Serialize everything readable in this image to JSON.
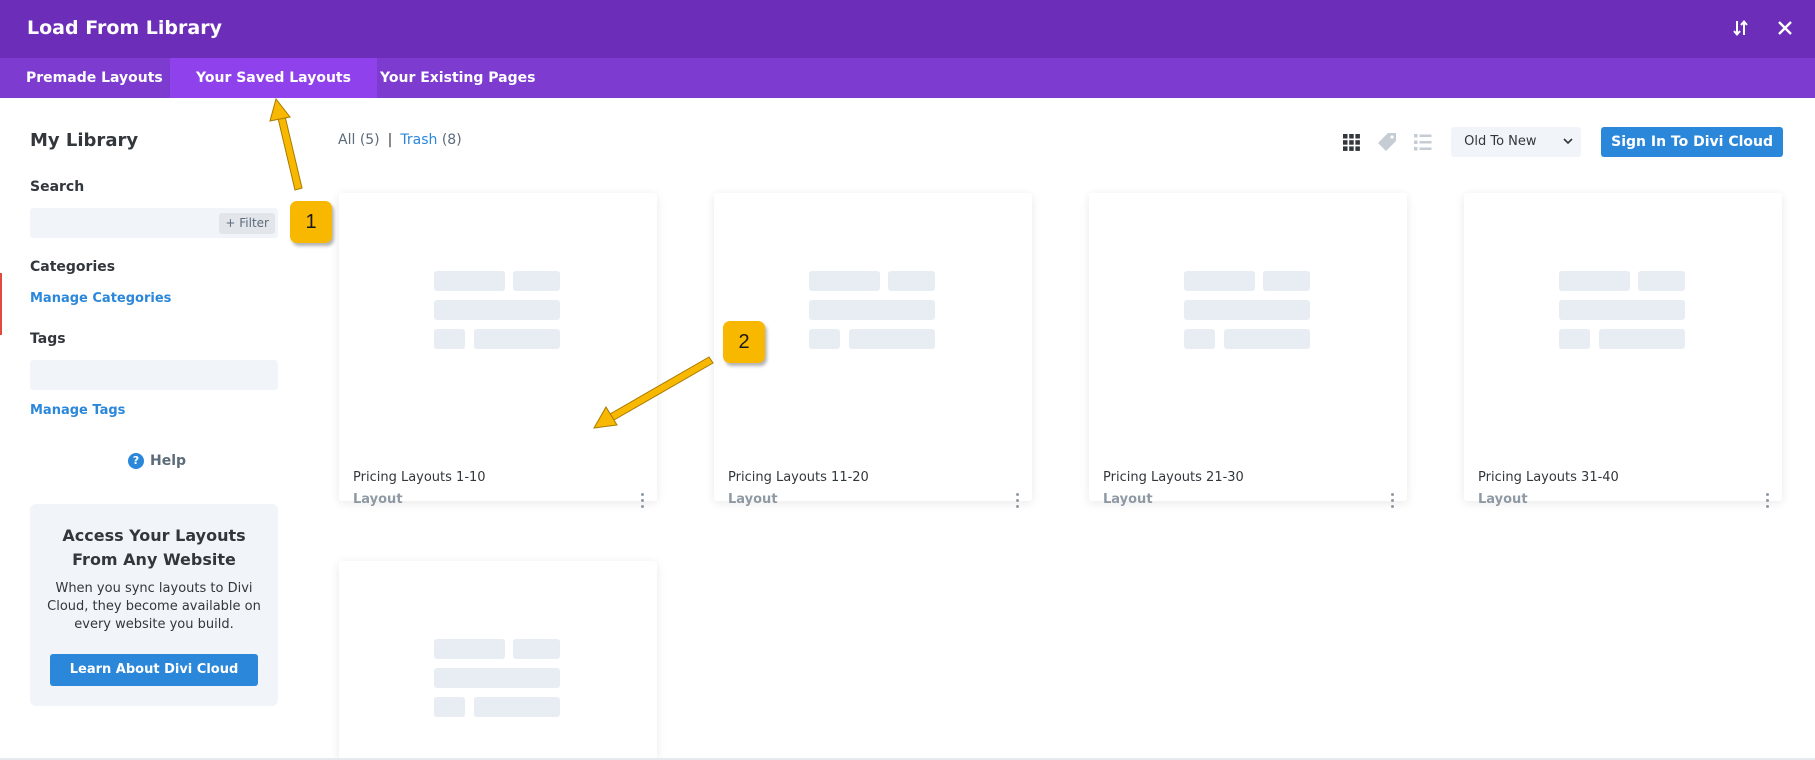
{
  "window": {
    "title": "Load From Library"
  },
  "title_icons": [
    {
      "name": "sort-arrows-icon"
    },
    {
      "name": "close-icon"
    }
  ],
  "tabs": [
    {
      "label": "Premade Layouts",
      "active": false
    },
    {
      "label": "Your Saved Layouts",
      "active": true
    },
    {
      "label": "Your Existing Pages",
      "active": false
    }
  ],
  "sidebar": {
    "heading": "My Library",
    "search_label": "Search",
    "search_placeholder": "",
    "filter_label": "+ Filter",
    "categories_label": "Categories",
    "manage_categories": "Manage Categories",
    "tags_label": "Tags",
    "manage_tags": "Manage Tags",
    "help_icon_glyph": "?",
    "help_label": "Help",
    "promo": {
      "title": "Access Your Layouts From Any Website",
      "text": "When you sync layouts to Divi Cloud, they become available on every website you build.",
      "button": "Learn About Divi Cloud"
    }
  },
  "filter": {
    "all_label": "All",
    "all_count": "(5)",
    "separator": "|",
    "trash_label": "Trash",
    "trash_count": "(8)"
  },
  "toolbar": {
    "view_icons": [
      "grid-view-icon",
      "tag-icon",
      "list-view-icon"
    ],
    "sort_value": "Old To New",
    "signin_button": "Sign In To Divi Cloud"
  },
  "cards": [
    {
      "title": "Pricing Layouts 1-10",
      "type": "Layout"
    },
    {
      "title": "Pricing Layouts 11-20",
      "type": "Layout"
    },
    {
      "title": "Pricing Layouts 21-30",
      "type": "Layout"
    },
    {
      "title": "Pricing Layouts 31-40",
      "type": "Layout"
    },
    {
      "title": "",
      "type": ""
    }
  ],
  "annotations": {
    "callout_1": "1",
    "callout_2": "2",
    "color": "#f9b800"
  },
  "colors": {
    "titlebar": "#6c2eb9",
    "tabbar": "#7e3bd0",
    "active_tab": "#8f42ec",
    "link_blue": "#2b87da"
  }
}
